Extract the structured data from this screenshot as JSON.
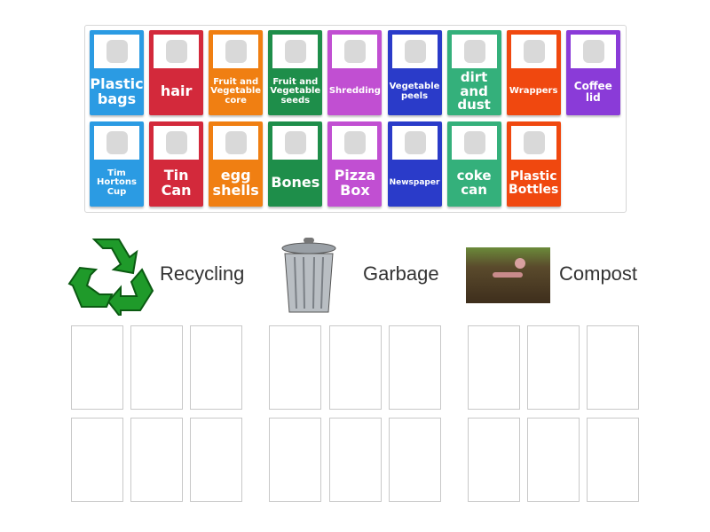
{
  "tiles": [
    {
      "label": "Plastic bags",
      "color": "#2b9be3",
      "size": 16,
      "img": "plastic-bag"
    },
    {
      "label": "hair",
      "color": "#d3293b",
      "size": 16,
      "img": "hair"
    },
    {
      "label": "Fruit and Vegetable core",
      "color": "#f07f12",
      "size": 10,
      "img": "apple-core"
    },
    {
      "label": "Fruit and Vegetable seeds",
      "color": "#1e8e4a",
      "size": 10,
      "img": "avocado"
    },
    {
      "label": "Shredding",
      "color": "#c14fd2",
      "size": 10,
      "img": "shredded-paper"
    },
    {
      "label": "Vegetable peels",
      "color": "#2a3bc9",
      "size": 10,
      "img": "vegetable-peels"
    },
    {
      "label": "dirt and dust",
      "color": "#34b07b",
      "size": 15,
      "img": "dirt"
    },
    {
      "label": "Wrappers",
      "color": "#f0480f",
      "size": 10,
      "img": "wrappers"
    },
    {
      "label": "Coffee lid",
      "color": "#8a3bd8",
      "size": 12,
      "img": "coffee-lid"
    },
    {
      "label": "Tim Hortons Cup",
      "color": "#2b9be3",
      "size": 10,
      "img": "coffee-cup"
    },
    {
      "label": "Tin Can",
      "color": "#d3293b",
      "size": 16,
      "img": "tin-can"
    },
    {
      "label": "egg shells",
      "color": "#f07f12",
      "size": 16,
      "img": "egg-shells"
    },
    {
      "label": "Bones",
      "color": "#1e8e4a",
      "size": 16,
      "img": "bones"
    },
    {
      "label": "Pizza Box",
      "color": "#c14fd2",
      "size": 16,
      "img": "pizza-box"
    },
    {
      "label": "Newspaper",
      "color": "#2a3bc9",
      "size": 9,
      "img": "newspaper"
    },
    {
      "label": "coke can",
      "color": "#34b07b",
      "size": 15,
      "img": "coke-can"
    },
    {
      "label": "Plastic Bottles",
      "color": "#f0480f",
      "size": 14,
      "img": "plastic-bottles"
    }
  ],
  "groups": [
    {
      "label": "Recycling",
      "icon": "recycle-icon"
    },
    {
      "label": "Garbage",
      "icon": "trash-can-icon"
    },
    {
      "label": "Compost",
      "icon": "compost-image"
    }
  ]
}
